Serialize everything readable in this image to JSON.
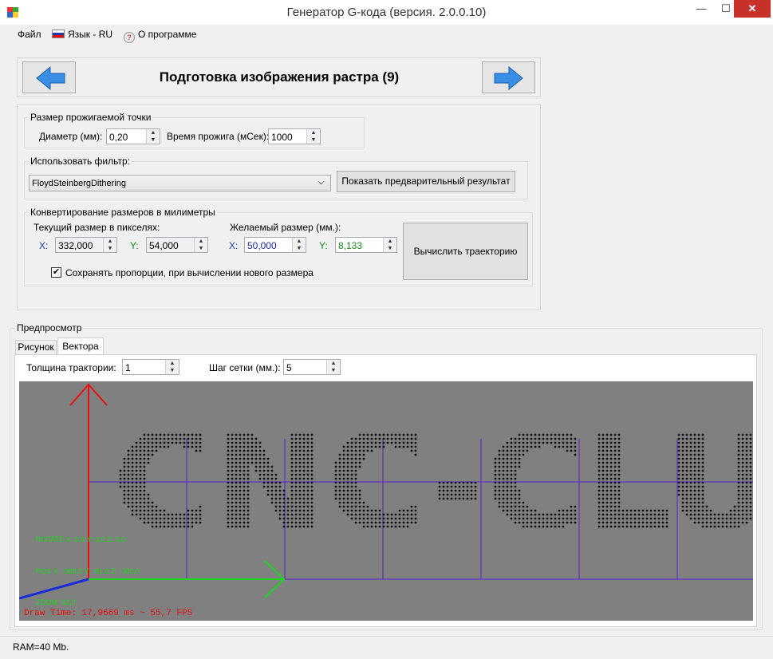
{
  "window": {
    "title": "Генератор G-кода (версия. 2.0.0.10)",
    "minimize": "—",
    "maximize": "☐",
    "close": "✕"
  },
  "menu": {
    "file": "Файл",
    "language": "Язык - RU",
    "about": "О программе"
  },
  "header": {
    "title": "Подготовка изображения растра (9)"
  },
  "burn_point": {
    "group_label": "Размер прожигаемой точки",
    "diameter_label": "Диаметр (мм):",
    "diameter_value": "0,20",
    "time_label": "Время прожига (мСек):",
    "time_value": "1000"
  },
  "filter": {
    "group_label": "Использовать фильтр:",
    "selected": "FloydSteinbergDithering",
    "preview_button": "Показать предварительный результат"
  },
  "convert": {
    "group_label": "Конвертирование размеров в милиметры",
    "current_label": "Текущий размер в пикселях:",
    "desired_label": "Желаемый размер (мм.):",
    "x_label": "X:",
    "y_label": "Y:",
    "current_x": "332,000",
    "current_y": "54,000",
    "desired_x": "50,000",
    "desired_y": "8,133",
    "keep_ratio_label": "Сохранять пропорции, при вычислении нового размера",
    "keep_ratio_checked": true,
    "calc_button": "Вычислить траекторию"
  },
  "preview": {
    "group_label": "Предпросмотр",
    "tabs": [
      "Рисунок",
      "Вектора"
    ],
    "active_tab": "Вектора",
    "thickness_label": "Толщина трактории:",
    "thickness_value": "1",
    "grid_label": "Шаг сетки (мм.):",
    "grid_value": "5",
    "overlay": {
      "rotate": "ROTATE X: 0,0  Y: 0,0 Z: 0,0",
      "pos": "POS X: -308,0  Y: -81,0 Z: -300,0",
      "zoom": "ZOOM: 62,0",
      "draw_time": "Draw Time: 17,9669 ms ~ 55,7 FPS"
    },
    "text_shown": "CNC-CLUB",
    "colors": {
      "background": "#808080",
      "grid": "#5a1fd1",
      "x_axis": "#18d818",
      "y_axis": "#e81010",
      "z_axis": "#1a2cd8",
      "dots": "#111111"
    }
  },
  "status": {
    "ram": "RAM=40 Mb."
  }
}
